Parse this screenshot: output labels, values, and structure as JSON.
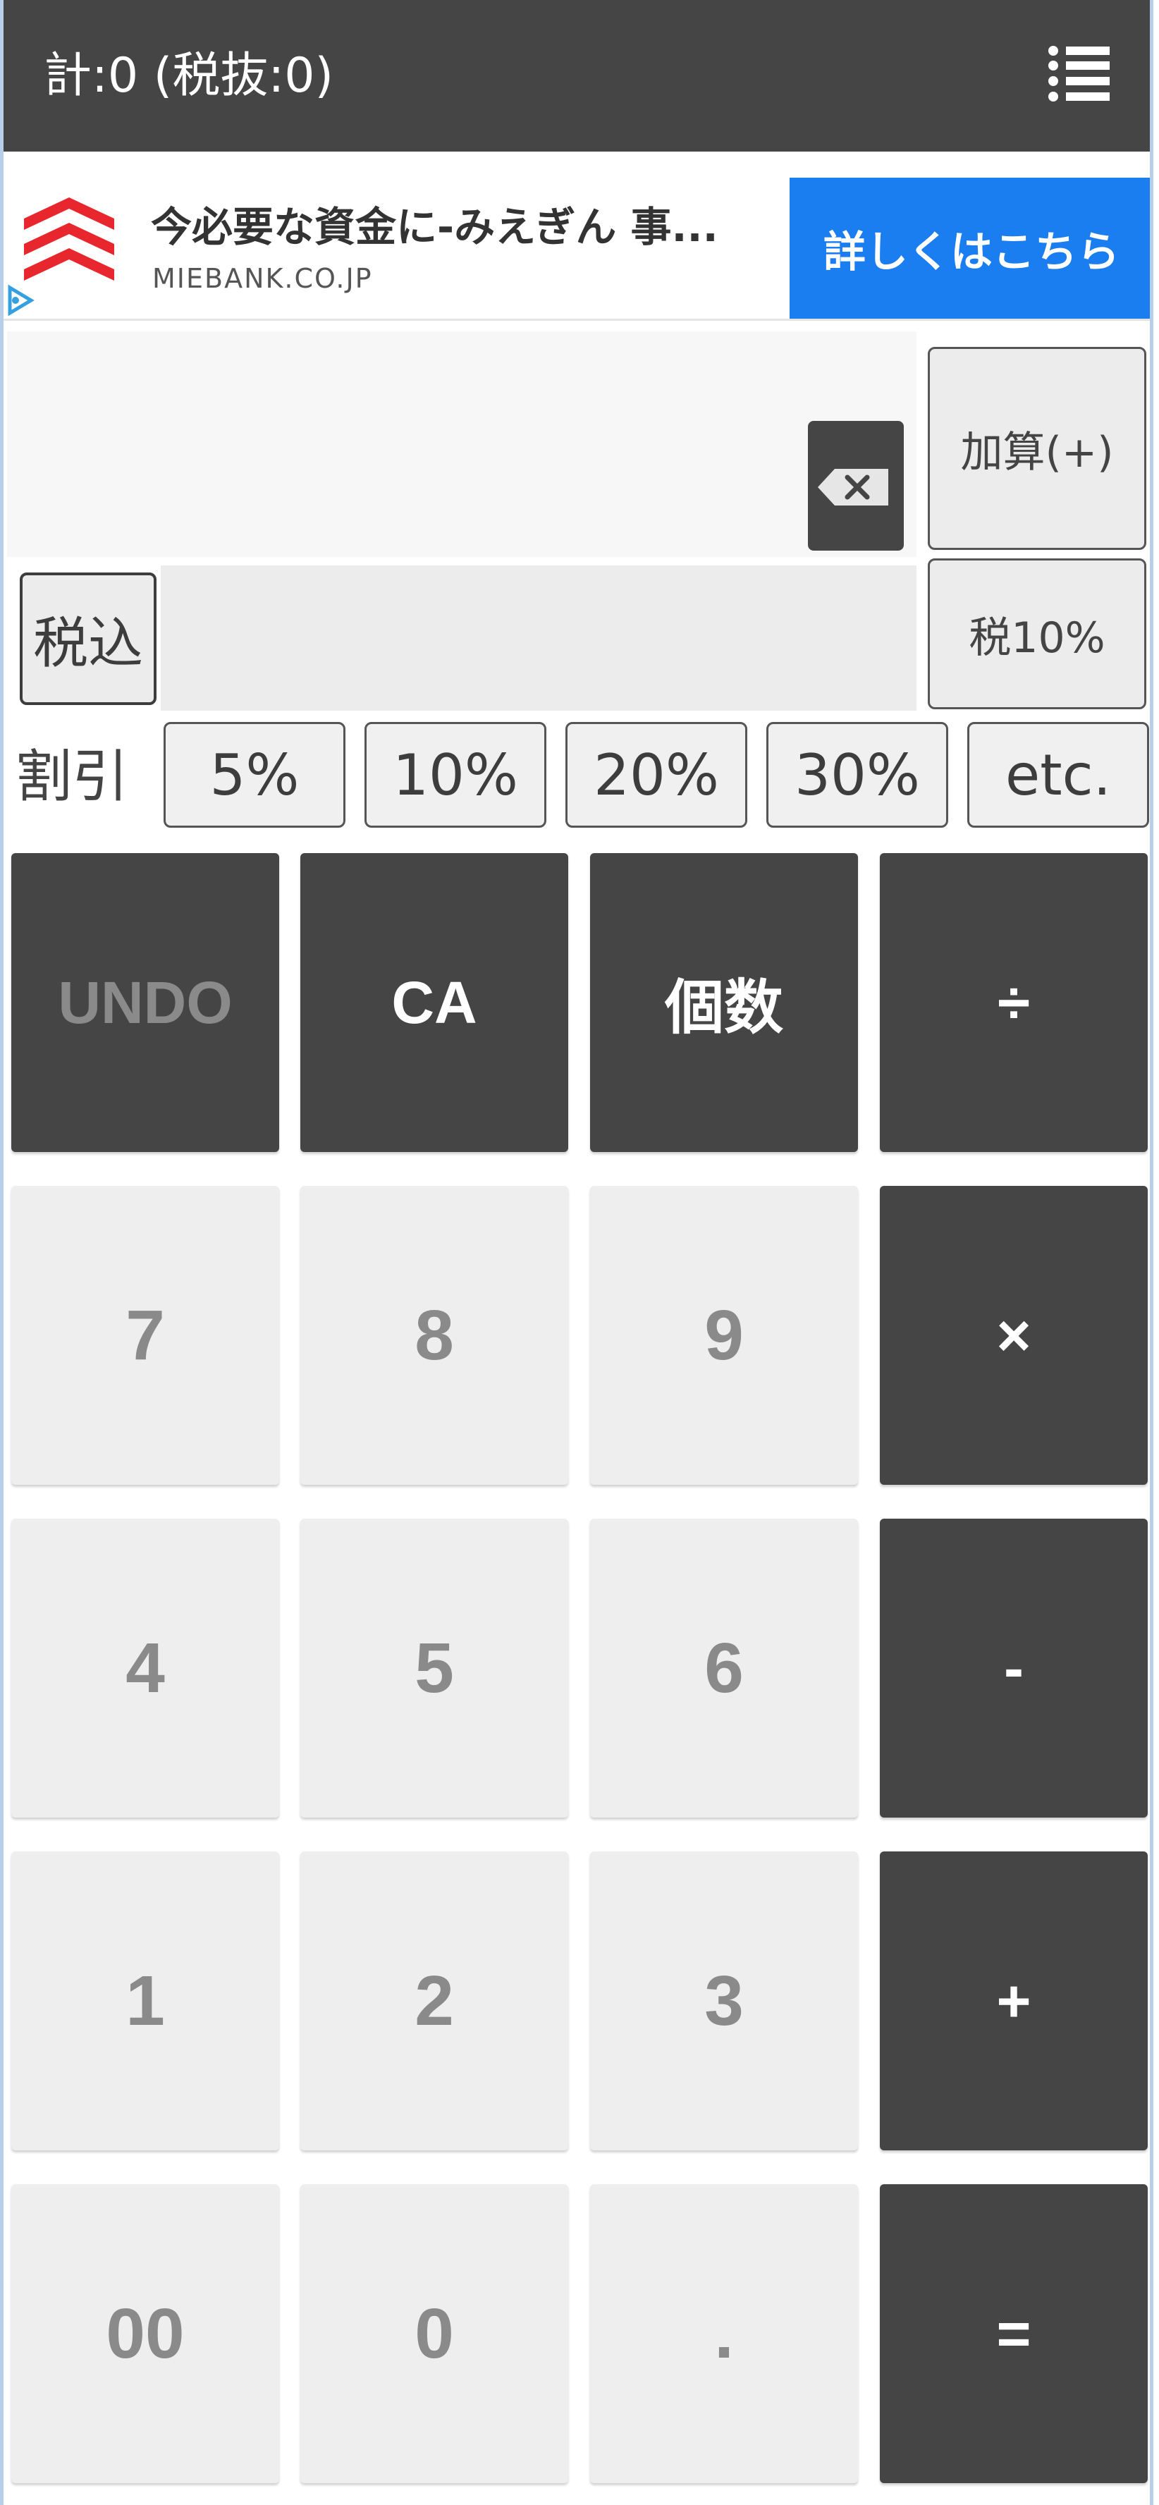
{
  "header": {
    "title": "計:0 (税抜:0)",
    "menu_icon": "menu-list-icon"
  },
  "ad": {
    "title": "今必要な資金に-みえぎん 事...",
    "domain": "MIEBANK.CO.JP",
    "cta": "詳しくはこちら",
    "brand_color": "#e8262d",
    "cta_color": "#1a7df0"
  },
  "input": {
    "value": "",
    "backspace_icon": "backspace-icon",
    "add_button": "加算(+)",
    "tax_button": "税10%",
    "tax_included": "税込"
  },
  "discount": {
    "label": "割引",
    "options": [
      "5%",
      "10%",
      "20%",
      "30%",
      "etc."
    ]
  },
  "keypad": {
    "undo": "UNDO",
    "clear_all": "CA",
    "count": "個数",
    "divide": "÷",
    "multiply": "×",
    "minus": "-",
    "plus": "+",
    "equals": "=",
    "k7": "7",
    "k8": "8",
    "k9": "9",
    "k4": "4",
    "k5": "5",
    "k6": "6",
    "k1": "1",
    "k2": "2",
    "k3": "3",
    "k00": "00",
    "k0": "0",
    "dot": "."
  },
  "colors": {
    "dark_key": "#454545",
    "light_key": "#eeeeee"
  }
}
